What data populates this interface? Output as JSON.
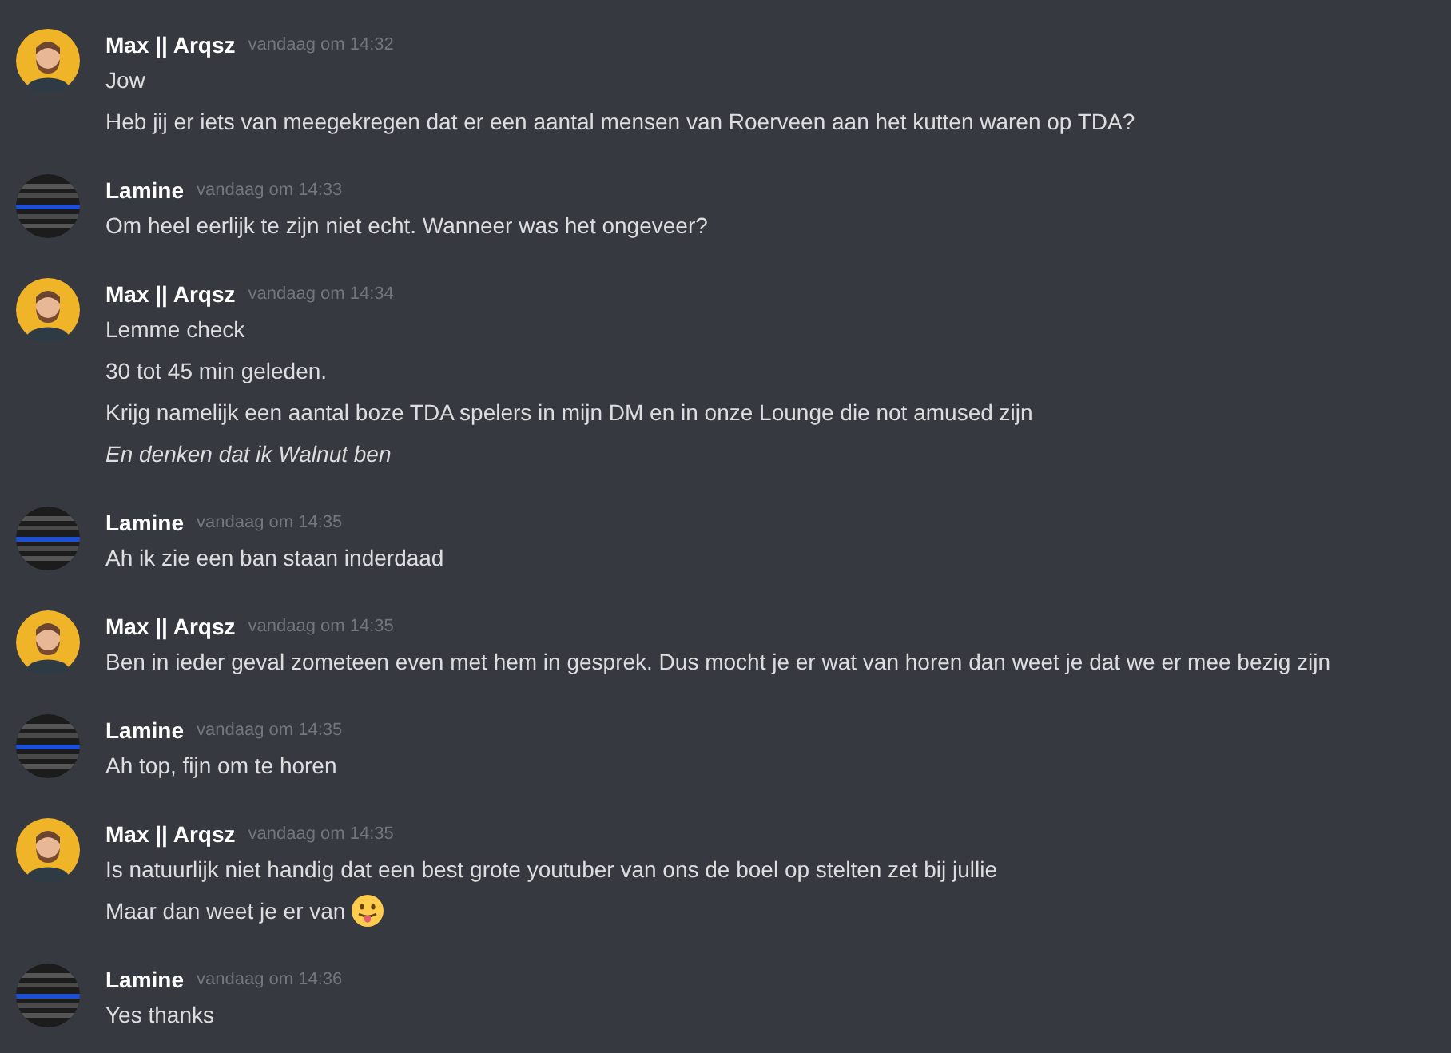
{
  "messages": [
    {
      "author": "Max || Arqsz",
      "kind": "cartoon",
      "time": "vandaag om 14:32",
      "lines": [
        {
          "kind": "plain",
          "text": "Jow"
        },
        {
          "kind": "plain",
          "text": "Heb jij er iets van meegekregen dat er een aantal mensen van Roerveen aan het kutten waren op TDA?"
        }
      ]
    },
    {
      "author": "Lamine",
      "kind": "flag",
      "time": "vandaag om 14:33",
      "lines": [
        {
          "kind": "plain",
          "text": "Om heel eerlijk te zijn niet echt. Wanneer was het ongeveer?"
        }
      ]
    },
    {
      "author": "Max || Arqsz",
      "kind": "cartoon",
      "time": "vandaag om 14:34",
      "lines": [
        {
          "kind": "plain",
          "text": "Lemme check"
        },
        {
          "kind": "plain",
          "text": "30 tot 45 min geleden."
        },
        {
          "kind": "plain",
          "text": "Krijg namelijk een aantal boze TDA spelers in mijn DM en in onze Lounge die not amused zijn"
        },
        {
          "kind": "italic",
          "text": "En denken dat ik Walnut ben"
        }
      ]
    },
    {
      "author": "Lamine",
      "kind": "flag",
      "time": "vandaag om 14:35",
      "lines": [
        {
          "kind": "plain",
          "text": "Ah ik zie een ban staan inderdaad"
        }
      ]
    },
    {
      "author": "Max || Arqsz",
      "kind": "cartoon",
      "time": "vandaag om 14:35",
      "lines": [
        {
          "kind": "plain",
          "text": "Ben in ieder geval zometeen even met hem in gesprek. Dus mocht je er wat van horen dan weet je dat we er mee bezig zijn"
        }
      ]
    },
    {
      "author": "Lamine",
      "kind": "flag",
      "time": "vandaag om 14:35",
      "lines": [
        {
          "kind": "plain",
          "text": "Ah top, fijn om te horen"
        }
      ]
    },
    {
      "author": "Max || Arqsz",
      "kind": "cartoon",
      "time": "vandaag om 14:35",
      "lines": [
        {
          "kind": "plain",
          "text": "Is natuurlijk niet handig dat een best grote youtuber van ons de boel op stelten zet bij jullie"
        },
        {
          "kind": "emoji",
          "text": "Maar dan weet je er van"
        }
      ]
    },
    {
      "author": "Lamine",
      "kind": "flag",
      "time": "vandaag om 14:36",
      "lines": [
        {
          "kind": "plain",
          "text": "Yes thanks"
        }
      ]
    }
  ]
}
